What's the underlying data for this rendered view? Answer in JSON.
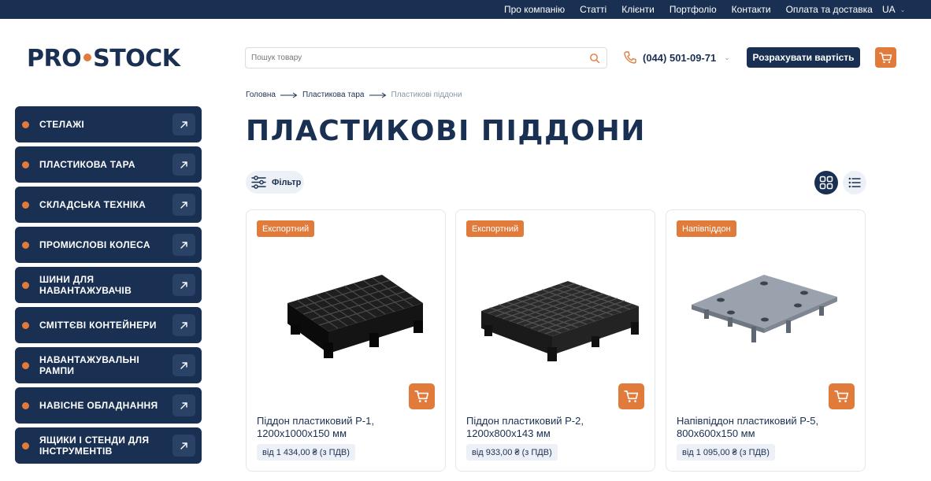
{
  "top_nav": {
    "links": [
      "Про компанію",
      "Статті",
      "Клієнти",
      "Портфоліо",
      "Контакти",
      "Оплата та доставка"
    ],
    "language": "UA"
  },
  "header": {
    "logo_left": "PRO",
    "logo_right": "STOCK",
    "search_placeholder": "Пошук товару",
    "phone": "(044) 501-09-71",
    "cta_label": "Розрахувати вартість"
  },
  "sidebar": {
    "items": [
      {
        "label": "СТЕЛАЖІ"
      },
      {
        "label": "ПЛАСТИКОВА ТАРА"
      },
      {
        "label": "СКЛАДСЬКА ТЕХНІКА"
      },
      {
        "label": "ПРОМИСЛОВІ КОЛЕСА"
      },
      {
        "label": "ШИНИ ДЛЯ НАВАНТАЖУВАЧІВ"
      },
      {
        "label": "СМІТТЄВІ КОНТЕЙНЕРИ"
      },
      {
        "label": "НАВАНТАЖУВАЛЬНІ РАМПИ"
      },
      {
        "label": "НАВІСНЕ ОБЛАДНАННЯ"
      },
      {
        "label": "ЯЩИКИ І СТЕНДИ ДЛЯ ІНСТРУМЕНТІВ"
      }
    ]
  },
  "breadcrumb": {
    "home": "Головна",
    "parent": "Пластикова тара",
    "current": "Пластикові піддони"
  },
  "page": {
    "title": "ПЛАСТИКОВІ ПІДДОНИ",
    "filter_label": "Фільтр"
  },
  "products": [
    {
      "badge": "Експортний",
      "name": "Піддон пластиковий Р-1, 1200х1000х150 мм",
      "price": "від 1 434,00 ₴ (з ПДВ)"
    },
    {
      "badge": "Експортний",
      "name": "Піддон пластиковий Р-2, 1200х800х143 мм",
      "price": "від 933,00 ₴ (з ПДВ)"
    },
    {
      "badge": "Напівпіддон",
      "name": "Напівпіддон пластиковий Р-5, 800х600х150 мм",
      "price": "від 1 095,00 ₴ (з ПДВ)"
    }
  ],
  "colors": {
    "navy": "#1a3052",
    "accent": "#e07b3c",
    "light": "#edf1f7"
  },
  "icons": {
    "search": "search-icon",
    "phone": "phone-icon",
    "cart": "cart-icon",
    "arrow": "arrow-up-right-icon",
    "filter": "sliders-icon",
    "grid": "grid-view-icon",
    "list": "list-view-icon"
  }
}
